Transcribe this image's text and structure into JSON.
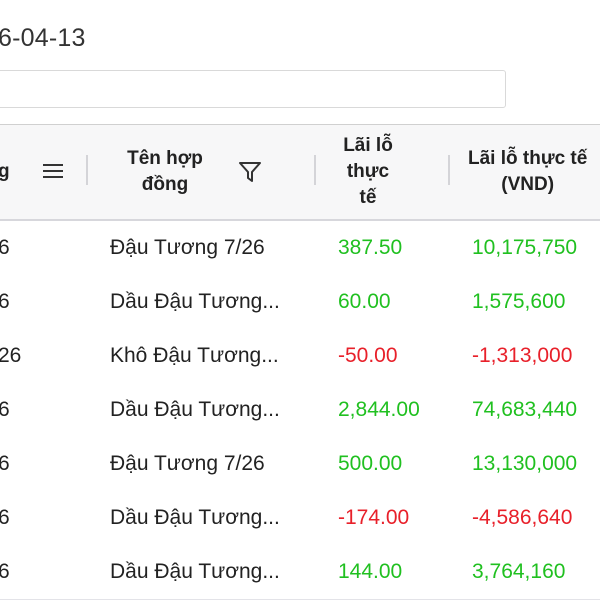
{
  "header_date": "6-04-13",
  "table": {
    "columns": {
      "code_partial": "g",
      "contract_name_line1": "Tên hợp",
      "contract_name_line2": "đồng",
      "real_pnl_line1": "Lãi lỗ",
      "real_pnl_line2": "thực",
      "real_pnl_line3": "tế",
      "real_pnl_vnd_line1": "Lãi lỗ thực tế",
      "real_pnl_vnd_line2": "(VND)"
    },
    "rows": [
      {
        "code": "6",
        "name": "Đậu Tương 7/26",
        "pnl": "387.50",
        "pnl_vnd": "10,175,750",
        "sign": "pos"
      },
      {
        "code": "6",
        "name": "Dầu Đậu Tương...",
        "pnl": "60.00",
        "pnl_vnd": "1,575,600",
        "sign": "pos"
      },
      {
        "code": "26",
        "name": "Khô Đậu Tương...",
        "pnl": "-50.00",
        "pnl_vnd": "-1,313,000",
        "sign": "neg"
      },
      {
        "code": "6",
        "name": "Dầu Đậu Tương...",
        "pnl": "2,844.00",
        "pnl_vnd": "74,683,440",
        "sign": "pos"
      },
      {
        "code": "6",
        "name": "Đậu Tương 7/26",
        "pnl": "500.00",
        "pnl_vnd": "13,130,000",
        "sign": "pos"
      },
      {
        "code": "6",
        "name": "Dầu Đậu Tương...",
        "pnl": "-174.00",
        "pnl_vnd": "-4,586,640",
        "sign": "neg"
      },
      {
        "code": "6",
        "name": "Dầu Đậu Tương...",
        "pnl": "144.00",
        "pnl_vnd": "3,764,160",
        "sign": "pos"
      }
    ]
  },
  "colors": {
    "positive": "#20c020",
    "negative": "#e8202a",
    "header_bg": "#f7f7f8"
  },
  "icons": {
    "column_menu": "menu-icon",
    "filter": "filter-icon"
  }
}
